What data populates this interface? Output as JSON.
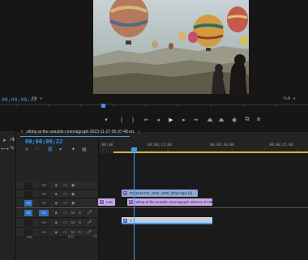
{
  "program_monitor": {
    "timecode": "00;00;08;22",
    "zoom_select": "Fit",
    "resolution_select": "Full"
  },
  "transport": {
    "buttons": [
      {
        "name": "marker-icon",
        "glyph": "▾"
      },
      {
        "name": "mark-in-icon",
        "glyph": "{"
      },
      {
        "name": "mark-out-icon",
        "glyph": "}"
      },
      {
        "name": "go-to-in-icon",
        "glyph": "⇤"
      },
      {
        "name": "step-back-icon",
        "glyph": "◂|"
      },
      {
        "name": "play-icon",
        "glyph": "▶"
      },
      {
        "name": "step-forward-icon",
        "glyph": "|▸"
      },
      {
        "name": "go-to-out-icon",
        "glyph": "⇥"
      },
      {
        "name": "lift-icon",
        "glyph": "⏏"
      },
      {
        "name": "extract-icon",
        "glyph": "⏏"
      },
      {
        "name": "camera-icon",
        "glyph": "◉"
      },
      {
        "name": "button-editor-icon",
        "glyph": "⧉"
      },
      {
        "name": "compare-icon",
        "glyph": "⧈"
      }
    ]
  },
  "sequence": {
    "tab_name": "sitting-at-the-seaside-cinemagraph-2023-11-27-05-07-48-utc",
    "timecode": "00;00;08;22",
    "ruler_labels": [
      ":00;00",
      "00;00;15;00",
      "00;00;30;00",
      "00;00;45;00"
    ]
  },
  "tracks": [
    {
      "id": "v3",
      "src": "",
      "name": "V3",
      "type": "video"
    },
    {
      "id": "v2",
      "src": "",
      "name": "V2",
      "type": "video"
    },
    {
      "id": "v1",
      "src": "V1",
      "name": "V1",
      "type": "video"
    },
    {
      "id": "a1",
      "src": "A1",
      "name": "A1",
      "type": "audio"
    },
    {
      "id": "a2",
      "src": "",
      "name": "A2",
      "type": "audio"
    },
    {
      "id": "a3",
      "src": "",
      "name": "A3",
      "type": "audio"
    }
  ],
  "mix": {
    "label": "Mix",
    "value": "0.0"
  },
  "clips": {
    "v3": "0013442-HD_1920_1080_24fps Mp4 [V]",
    "v1_left": "Lam",
    "v1_right": "sitting-at-the-seaside-cinemagraph-2023-11-27-05-07",
    "a1": "A"
  },
  "colors": {
    "accent_blue": "#3c9bf0",
    "work_area": "#c9b83a",
    "clip_video_blue": "#8fa8d4",
    "clip_video_purple": "#c7a9e6"
  }
}
